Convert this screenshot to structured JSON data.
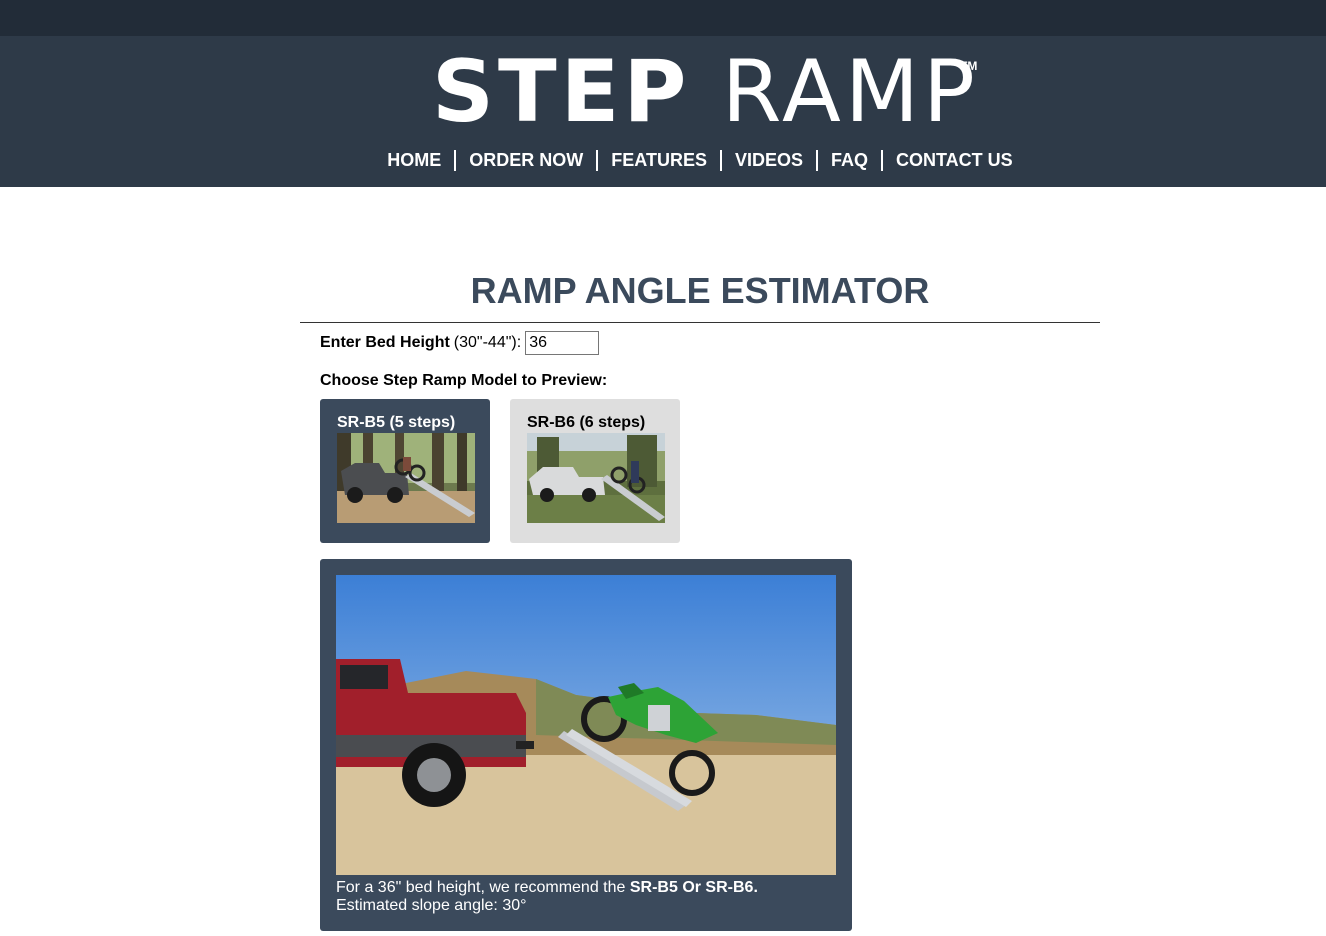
{
  "brand": {
    "logo_step": "STEP",
    "logo_ramp": "RAMP",
    "logo_tm": "TM"
  },
  "nav": {
    "items": [
      {
        "label": "HOME"
      },
      {
        "label": "ORDER NOW"
      },
      {
        "label": "FEATURES"
      },
      {
        "label": "VIDEOS"
      },
      {
        "label": "FAQ"
      },
      {
        "label": "CONTACT US"
      }
    ]
  },
  "main": {
    "title": "RAMP ANGLE ESTIMATOR",
    "bed_label": "Enter Bed Height",
    "bed_range": "(30\"-44\"):",
    "bed_value": "36",
    "choose_label": "Choose Step Ramp Model to Preview:",
    "models": [
      {
        "name": "SR-B5 (5 steps)",
        "selected": true
      },
      {
        "name": "SR-B6 (6 steps)",
        "selected": false
      }
    ],
    "result_prefix": "For a 36\" bed height, we recommend the",
    "result_models": "SR-B5 Or SR-B6.",
    "slope_text": "Estimated slope angle: 30°"
  },
  "colors": {
    "header_bg": "#2e3a48",
    "topbar_bg": "#222c38",
    "accent": "#3b4a5c",
    "inactive_card": "#dedede"
  }
}
